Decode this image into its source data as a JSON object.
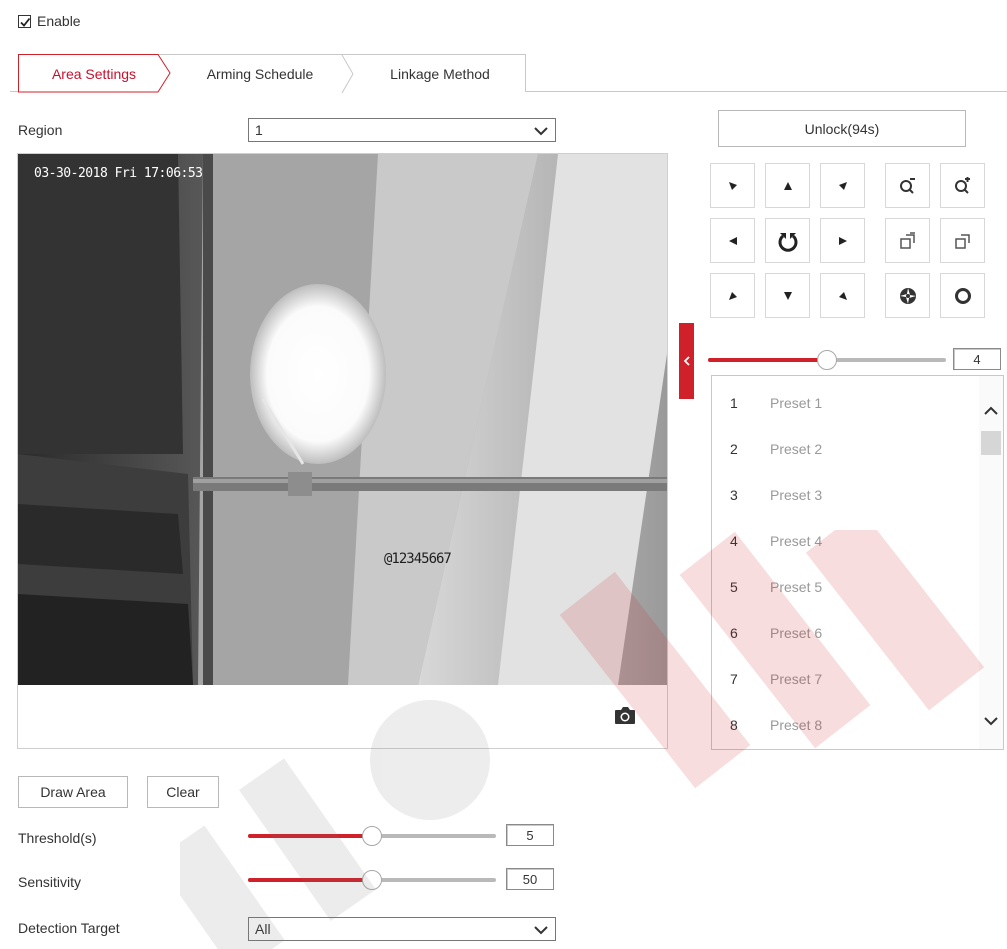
{
  "enable": {
    "label": "Enable",
    "checked": true
  },
  "tabs": [
    {
      "label": "Area Settings",
      "active": true
    },
    {
      "label": "Arming Schedule",
      "active": false
    },
    {
      "label": "Linkage Method",
      "active": false
    }
  ],
  "region": {
    "label": "Region",
    "value": "1"
  },
  "video": {
    "timestamp": "03-30-2018 Fri 17:06:53",
    "osd_text": "@12345667"
  },
  "ptz": {
    "unlock_label": "Unlock(94s)",
    "direction_icons": [
      "down-left-arrow-icon",
      "up-arrow-icon",
      "down-right-arrow-icon",
      "left-arrow-icon",
      "auto-rotate-icon",
      "right-arrow-icon",
      "up-left-arrow-icon",
      "down-arrow-icon",
      "up-right-arrow-icon"
    ],
    "lens_icons": [
      "zoom-out-icon",
      "zoom-in-icon",
      "focus-near-icon",
      "focus-far-icon",
      "iris-close-icon",
      "iris-open-icon"
    ],
    "speed": {
      "value": "4",
      "fraction": 0.5
    }
  },
  "presets": [
    {
      "num": "1",
      "name": "Preset 1"
    },
    {
      "num": "2",
      "name": "Preset 2"
    },
    {
      "num": "3",
      "name": "Preset 3"
    },
    {
      "num": "4",
      "name": "Preset 4"
    },
    {
      "num": "5",
      "name": "Preset 5"
    },
    {
      "num": "6",
      "name": "Preset 6"
    },
    {
      "num": "7",
      "name": "Preset 7"
    },
    {
      "num": "8",
      "name": "Preset 8"
    }
  ],
  "actions": {
    "draw_area": "Draw Area",
    "clear": "Clear"
  },
  "threshold": {
    "label": "Threshold(s)",
    "value": "5",
    "fraction": 0.5
  },
  "sensitivity": {
    "label": "Sensitivity",
    "value": "50",
    "fraction": 0.5
  },
  "detection_target": {
    "label": "Detection Target",
    "value": "All"
  },
  "colors": {
    "accent": "#d0202a",
    "tab_active": "#c8102e"
  }
}
